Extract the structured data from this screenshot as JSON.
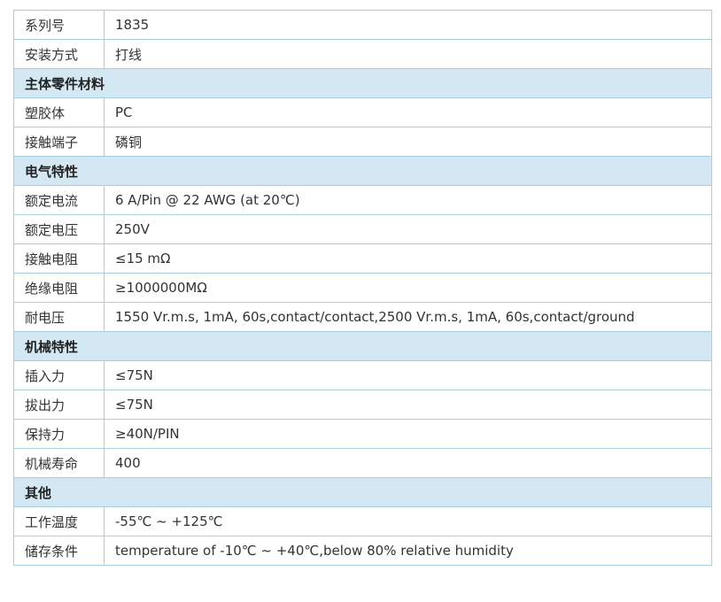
{
  "rows": [
    {
      "type": "row",
      "label": "系列号",
      "value": "1835"
    },
    {
      "type": "row",
      "label": "安装方式",
      "value": "打线"
    },
    {
      "type": "section",
      "label": "主体零件材料"
    },
    {
      "type": "row",
      "label": "塑胶体",
      "value": "PC"
    },
    {
      "type": "row",
      "label": "接触端子",
      "value": "磷铜"
    },
    {
      "type": "section",
      "label": "电气特性"
    },
    {
      "type": "row",
      "label": "额定电流",
      "value": "6 A/Pin @ 22 AWG  (at 20℃)"
    },
    {
      "type": "row",
      "label": "额定电压",
      "value": "250V"
    },
    {
      "type": "row",
      "label": "接触电阻",
      "value": "≤15 mΩ"
    },
    {
      "type": "row",
      "label": "绝缘电阻",
      "value": "≥1000000MΩ"
    },
    {
      "type": "row",
      "label": "耐电压",
      "value": "1550 Vr.m.s, 1mA, 60s,contact/contact,2500 Vr.m.s, 1mA, 60s,contact/ground"
    },
    {
      "type": "section",
      "label": "机械特性"
    },
    {
      "type": "row",
      "label": "插入力",
      "value": "≤75N"
    },
    {
      "type": "row",
      "label": "拔出力",
      "value": "≤75N"
    },
    {
      "type": "row",
      "label": "保持力",
      "value": "≥40N/PIN"
    },
    {
      "type": "row",
      "label": "机械寿命",
      "value": "400"
    },
    {
      "type": "section",
      "label": "其他"
    },
    {
      "type": "row",
      "label": "工作温度",
      "value": "-55℃ ~ +125℃"
    },
    {
      "type": "row",
      "label": "储存条件",
      "value": "temperature of -10℃ ~ +40℃,below 80% relative humidity"
    }
  ],
  "colors": {
    "border": "#a8cfe0",
    "section_background": "#d4e8f4",
    "text": "#333333"
  }
}
